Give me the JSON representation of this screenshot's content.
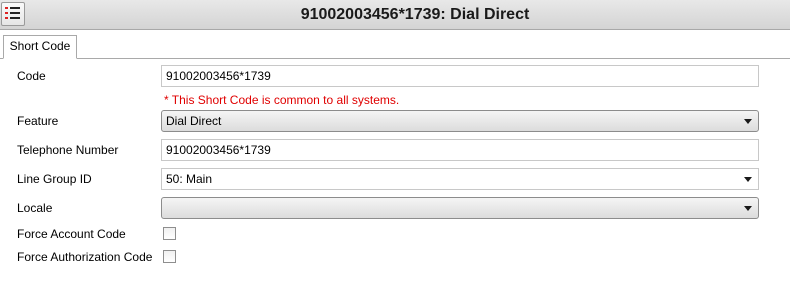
{
  "window": {
    "title": "91002003456*1739: Dial Direct",
    "icon": "list-settings-icon"
  },
  "tabs": [
    {
      "label": "Short Code",
      "selected": true
    }
  ],
  "form": {
    "code": {
      "label": "Code",
      "value": "91002003456*1739",
      "note": "* This Short Code is common to all systems."
    },
    "feature": {
      "label": "Feature",
      "value": "Dial Direct"
    },
    "telephone_number": {
      "label": "Telephone Number",
      "value": "91002003456*1739"
    },
    "line_group_id": {
      "label": "Line Group ID",
      "value": "50: Main"
    },
    "locale": {
      "label": "Locale",
      "value": ""
    },
    "force_account_code": {
      "label": "Force Account Code",
      "checked": false
    },
    "force_authorization_code": {
      "label": "Force Authorization Code",
      "checked": false
    }
  },
  "colors": {
    "note": "#e00000",
    "titlebar": "#dcdcdc"
  }
}
